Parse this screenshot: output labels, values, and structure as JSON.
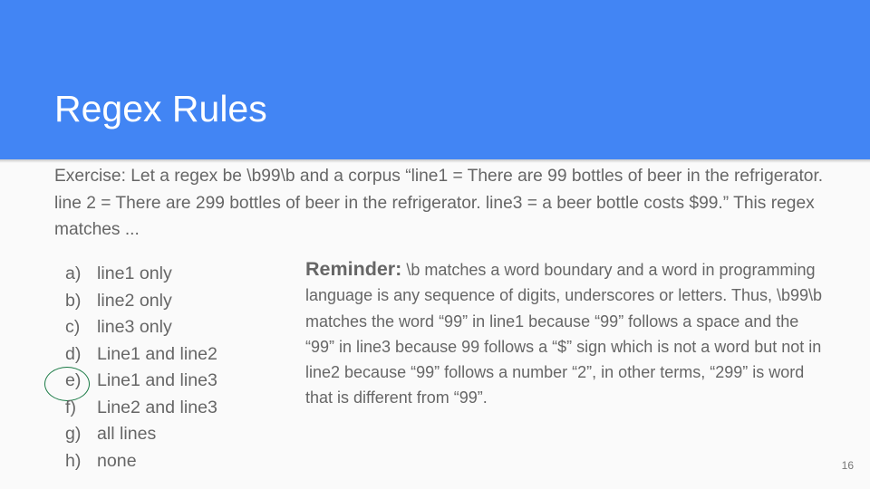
{
  "slide": {
    "title": "Regex Rules",
    "exercise": "Exercise: Let a regex be \\b99\\b and a corpus “line1 = There are 99 bottles of beer in the refrigerator.  line 2 = There are 299 bottles of beer in the refrigerator.  line3 = a beer bottle costs $99.” This regex matches ...",
    "options": [
      {
        "letter": "a)",
        "text": "line1 only"
      },
      {
        "letter": "b)",
        "text": "line2 only"
      },
      {
        "letter": "c)",
        "text": "line3 only"
      },
      {
        "letter": "d)",
        "text": "Line1 and line2"
      },
      {
        "letter": "e)",
        "text": "Line1 and line3"
      },
      {
        "letter": "f)",
        "text": "Line2 and line3"
      },
      {
        "letter": "g)",
        "text": "all lines"
      },
      {
        "letter": "h)",
        "text": "none"
      }
    ],
    "reminder_label": "Reminder:",
    "reminder_text": " \\b matches a word boundary and a word in programming language is any sequence of digits, underscores or letters. Thus, \\b99\\b matches the word “99” in line1 because “99” follows a space and the “99” in line3 because 99 follows a “$” sign which is not a word but not in line2 because “99” follows a number “2”, in other terms, “299” is word that is different from “99”.",
    "page_number": "16",
    "colors": {
      "header": "#4285f4",
      "circle": "#1a7a45"
    }
  }
}
